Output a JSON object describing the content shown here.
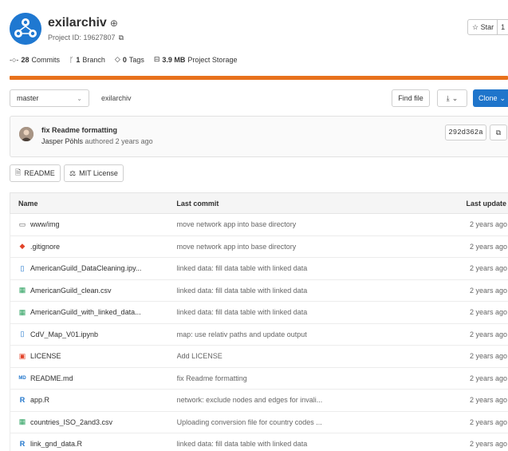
{
  "project": {
    "name": "exilarchiv",
    "id_text": "Project ID: 19627807",
    "star_label": "Star",
    "star_count": "1"
  },
  "stats": {
    "commits_count": "28",
    "commits_label": "Commits",
    "branch_count": "1",
    "branch_label": "Branch",
    "tags_count": "0",
    "tags_label": "Tags",
    "storage_size": "3.9 MB",
    "storage_label": "Project Storage"
  },
  "toolbar": {
    "branch": "master",
    "path": "exilarchiv",
    "find_file": "Find file",
    "clone": "Clone"
  },
  "last_commit": {
    "message": "fix Readme formatting",
    "author": "Jasper Pöhls",
    "suffix": "authored 2 years ago",
    "sha": "292d362a"
  },
  "badges": {
    "readme": "README",
    "license": "MIT License"
  },
  "table": {
    "headers": {
      "name": "Name",
      "commit": "Last commit",
      "date": "Last update"
    },
    "rows": [
      {
        "name": "www/img",
        "commit": "move network app into base directory",
        "date": "2 years ago",
        "icon": "folder-icon"
      },
      {
        "name": ".gitignore",
        "commit": "move network app into base directory",
        "date": "2 years ago",
        "icon": "git-icon"
      },
      {
        "name": "AmericanGuild_DataCleaning.ipy...",
        "commit": "linked data: fill data table with linked data",
        "date": "2 years ago",
        "icon": "notebook-file-icon"
      },
      {
        "name": "AmericanGuild_clean.csv",
        "commit": "linked data: fill data table with linked data",
        "date": "2 years ago",
        "icon": "csv-file-icon"
      },
      {
        "name": "AmericanGuild_with_linked_data...",
        "commit": "linked data: fill data table with linked data",
        "date": "2 years ago",
        "icon": "csv-file-icon"
      },
      {
        "name": "CdV_Map_V01.ipynb",
        "commit": "map: use relativ paths and update output",
        "date": "2 years ago",
        "icon": "notebook-file-icon"
      },
      {
        "name": "LICENSE",
        "commit": "Add LICENSE",
        "date": "2 years ago",
        "icon": "license-icon"
      },
      {
        "name": "README.md",
        "commit": "fix Readme formatting",
        "date": "2 years ago",
        "icon": "markdown-icon"
      },
      {
        "name": "app.R",
        "commit": "network: exclude nodes and edges for invali...",
        "date": "2 years ago",
        "icon": "r-file-icon"
      },
      {
        "name": "countries_ISO_2and3.csv",
        "commit": "Uploading conversion file for country codes ...",
        "date": "2 years ago",
        "icon": "csv-file-icon"
      },
      {
        "name": "link_gnd_data.R",
        "commit": "linked data: fill data table with linked data",
        "date": "2 years ago",
        "icon": "r-file-icon"
      }
    ]
  },
  "colors": {
    "accent": "#1f75cb",
    "language_bar": "#e8711c",
    "avatar": "#1f78d1"
  }
}
